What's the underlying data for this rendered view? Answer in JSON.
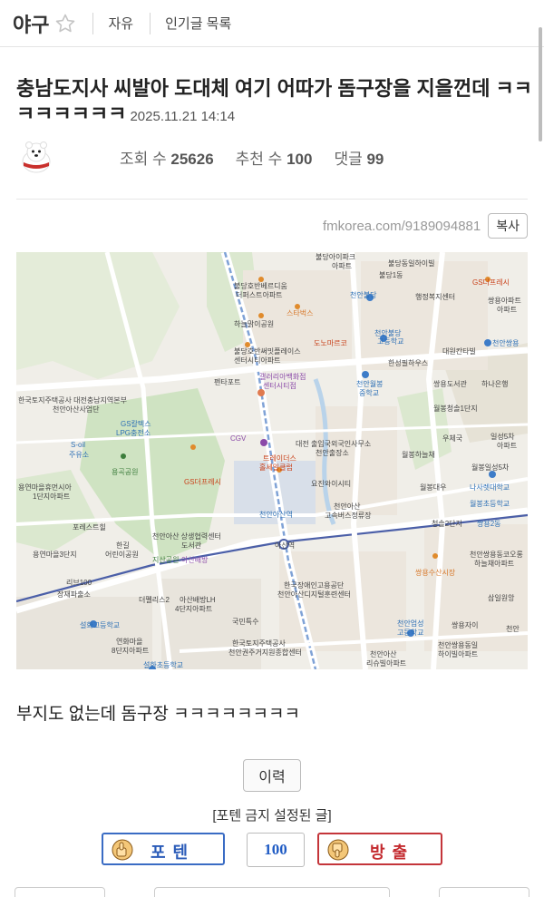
{
  "header": {
    "board_name": "야구",
    "nav": [
      "자유",
      "인기글 목록"
    ]
  },
  "post": {
    "title": "충남도지사 씨발아 도대체 여기 어따가 돔구장을 지을껀데 ㅋㅋㅋㅋㅋㅋㅋㅋ",
    "date": "2025.11.21 14:14",
    "views_label": "조회 수",
    "views": "25626",
    "recommend_label": "추천 수",
    "recommend": "100",
    "comments_label": "댓글",
    "comments": "99",
    "url": "fmkorea.com/9189094881",
    "copy_label": "복사",
    "body": "부지도 없는데 돔구장 ㅋㅋㅋㅋㅋㅋㅋㅋ"
  },
  "map": {
    "labels": {
      "l1": "불당아이파크",
      "l2": "아파트",
      "l3": "불당동일하이빌",
      "l4": "불당1동",
      "l5": "GS더프레시",
      "l6": "천안불당",
      "l7": "행정복지센터",
      "l8": "쌍용아파트",
      "l9": "불당호반베르디움",
      "l10": "더퍼스트아파트",
      "l11": "스타벅스",
      "l12": "하늘맑이공원",
      "l13": "도노마르코",
      "l14": "천안불당",
      "l15": "고등학교",
      "l16": "대원칸타빌",
      "l17": "천안쌍용",
      "l18": "불당호반써밋플레이스",
      "l19": "센터시티아파트",
      "l20": "한성필하우스",
      "l21": "펜타포트",
      "l22": "갤러리아백화점",
      "l23": "센터시티점",
      "l24": "천안월봉",
      "l25": "중학교",
      "l26": "쌍용도서관",
      "l27": "하나은행",
      "l28": "한국토지주택공사 대전충남지역본부",
      "l29": "천안아산사업단",
      "l30": "GS칼텍스",
      "l31": "LPG충전소",
      "l32": "CGV",
      "l33": "월봉청솔1단지",
      "l34": "우체국",
      "l35": "S-oil",
      "l36": "주유소",
      "l37": "용곡공원",
      "l38": "트레이더스",
      "l39": "홀세일클럽",
      "l40": "대전 출입국외국인사무소",
      "l41": "천안출장소",
      "l42": "월봉하늘채",
      "l43": "월봉일성5차",
      "l44": "용연마을휴먼시아",
      "l45": "1단지아파트",
      "l46": "GS더프레시",
      "l47": "요진와이시티",
      "l48": "월봉대우",
      "l49": "나사렛대학교",
      "l50": "포레스트힐",
      "l51": "천안아산역",
      "l52": "천안아산",
      "l53": "고속버스정류장",
      "l54": "청솔2단지",
      "l55": "쌍용2동",
      "l56": "용연마을3단지",
      "l57": "한길",
      "l58": "어린이공원",
      "l59": "천안아산 상생협력센터",
      "l60": "도서관",
      "l61": "지산공원",
      "l62": "아산배방",
      "l63": "아산역",
      "l64": "천안쌍용동코오롱",
      "l65": "하늘채아파트",
      "l66": "리브100",
      "l67": "장재파출소",
      "l68": "한국장애인고용공단",
      "l69": "천안아산디지털훈련센터",
      "l70": "쌍용수산시장",
      "l71": "삼일원앙",
      "l72": "더펠리스2",
      "l73": "아산배방LH",
      "l74": "4단지아파트",
      "l75": "설화고등학교",
      "l76": "국민특수",
      "l77": "천안업성",
      "l78": "고등학교",
      "l79": "쌍용자이",
      "l80": "천안",
      "l81": "한국토지주택공사",
      "l82": "천안권주거지원종합센터",
      "l83": "연화마을",
      "l84": "8단지아파트",
      "l85": "천안아산",
      "l86": "리슈빌아파트",
      "l87": "천안쌍용동일",
      "l88": "하이빌아파트",
      "l89": "설화초등학교",
      "l90": "일성5차",
      "l91": "아파트",
      "l92": "월봉초등학교",
      "l93": "아파트"
    }
  },
  "history_label": "이력",
  "notice": "[포텐 금지 설정된 글]",
  "vote": {
    "up_label": "포텐",
    "count": "100",
    "down_label": "방출"
  }
}
